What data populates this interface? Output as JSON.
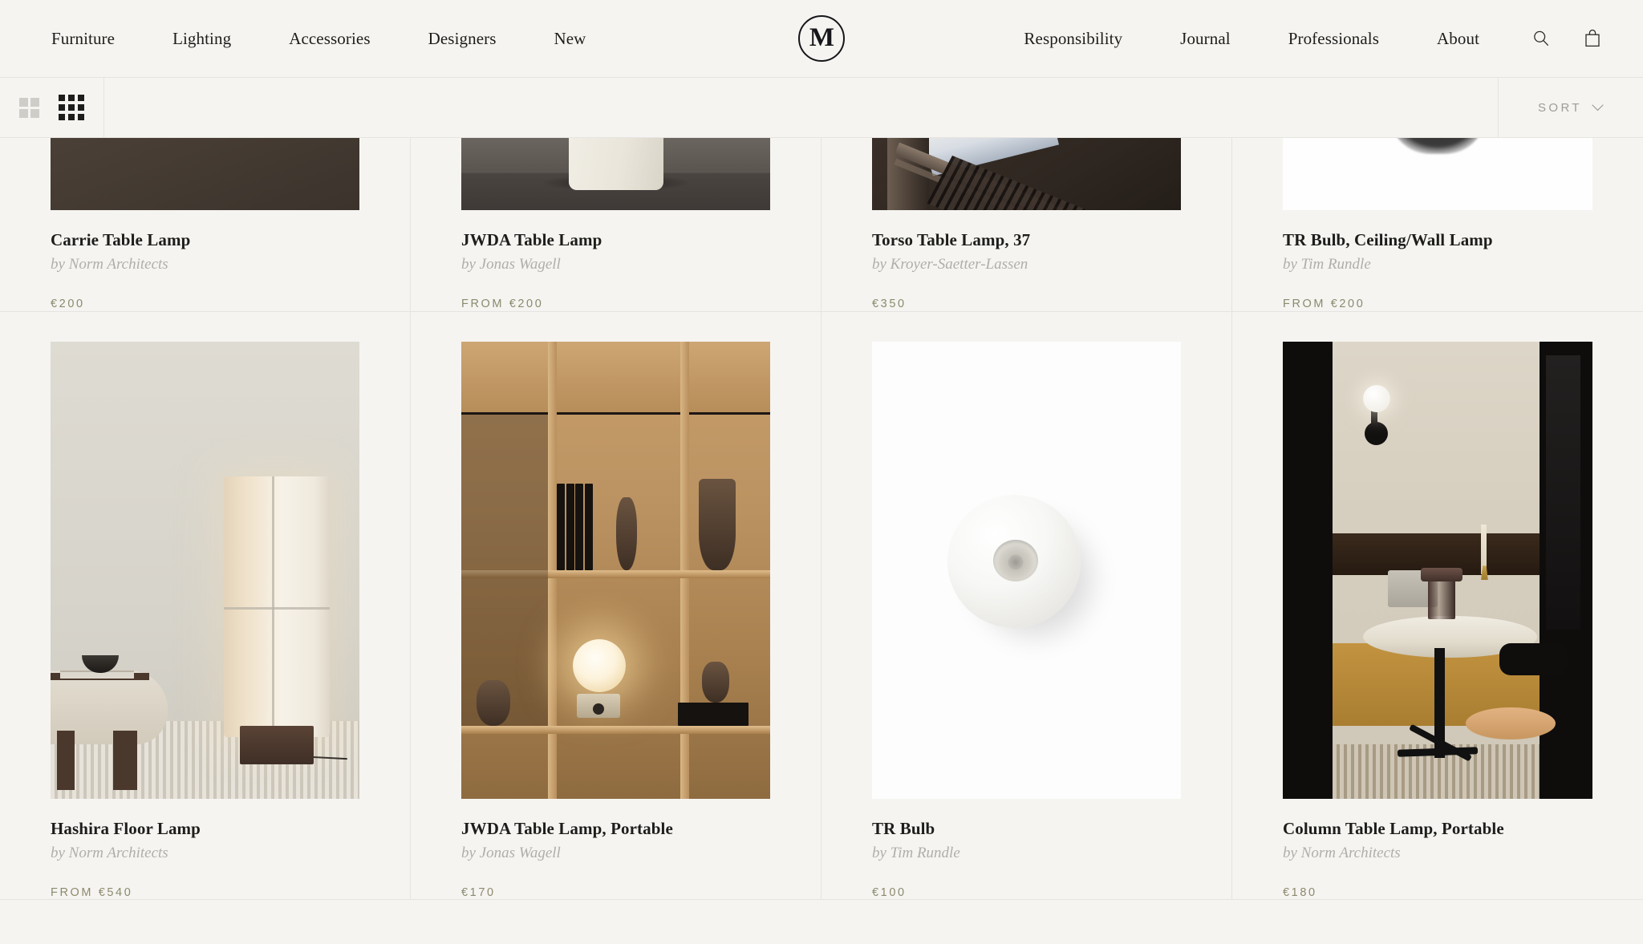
{
  "header": {
    "nav_left": [
      {
        "label": "Furniture"
      },
      {
        "label": "Lighting"
      },
      {
        "label": "Accessories"
      },
      {
        "label": "Designers"
      },
      {
        "label": "New"
      }
    ],
    "nav_right": [
      {
        "label": "Responsibility"
      },
      {
        "label": "Journal"
      },
      {
        "label": "Professionals"
      },
      {
        "label": "About"
      }
    ],
    "logo_letter": "M",
    "icons": {
      "search": "search-icon",
      "bag": "shopping-bag-icon"
    }
  },
  "toolbar": {
    "view_two_column": "grid-2-icon",
    "view_three_column": "grid-3-icon",
    "sort_label": "SORT",
    "sort_chevron": "chevron-down-icon"
  },
  "colors": {
    "page_background": "#f5f4f1",
    "text": "#1d1d1b",
    "designer_text": "#b0aeaa",
    "price": "#8b8a6d",
    "divider": "#e6e4df"
  },
  "products": [
    {
      "title": "Carrie Table Lamp",
      "designer": "by Norm Architects",
      "price": "€200",
      "image": "dark-brown-wall-lamp-scene"
    },
    {
      "title": "JWDA Table Lamp",
      "designer": "by Jonas Wagell",
      "price": "FROM €200",
      "image": "ceramic-lamp-on-dark-wood-table"
    },
    {
      "title": "Torso Table Lamp, 37",
      "designer": "by Kroyer-Saetter-Lassen",
      "price": "€350",
      "image": "dark-classical-stairwell"
    },
    {
      "title": "TR Bulb, Ceiling/Wall Lamp",
      "designer": "by Tim Rundle",
      "price": "FROM €200",
      "image": "white-ceiling-fixture"
    },
    {
      "title": "Hashira Floor Lamp",
      "designer": "by Norm Architects",
      "price": "FROM €540",
      "image": "hashira-floor-lamp-interior"
    },
    {
      "title": "JWDA Table Lamp, Portable",
      "designer": "by Jonas Wagell",
      "price": "€170",
      "image": "oak-shelving-with-portable-lamp"
    },
    {
      "title": "TR Bulb",
      "designer": "by Tim Rundle",
      "price": "€100",
      "image": "white-sphere-bulb-product-shot"
    },
    {
      "title": "Column Table Lamp, Portable",
      "designer": "by Norm Architects",
      "price": "€180",
      "image": "restaurant-booth-with-column-lamp"
    }
  ]
}
